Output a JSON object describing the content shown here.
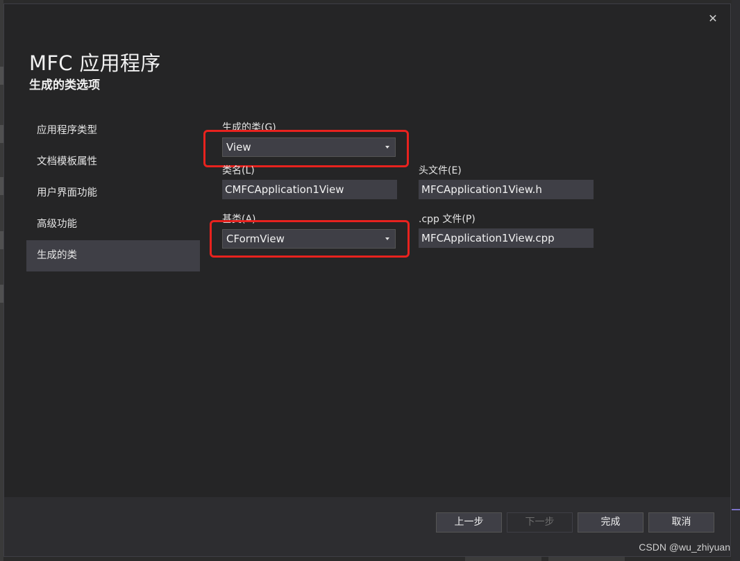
{
  "dialog": {
    "title": "MFC 应用程序",
    "subtitle": "生成的类选项",
    "close_glyph": "✕"
  },
  "nav": {
    "items": [
      {
        "label": "应用程序类型"
      },
      {
        "label": "文档模板属性"
      },
      {
        "label": "用户界面功能"
      },
      {
        "label": "高级功能"
      },
      {
        "label": "生成的类",
        "active": true
      }
    ]
  },
  "form": {
    "generated_class": {
      "label": "生成的类(G)",
      "value": "View"
    },
    "class_name": {
      "label": "类名(L)",
      "value": "CMFCApplication1View"
    },
    "header_file": {
      "label": "头文件(E)",
      "value": "MFCApplication1View.h"
    },
    "base_class": {
      "label": "基类(A)",
      "value": "CFormView"
    },
    "cpp_file": {
      "label": ".cpp 文件(P)",
      "value": "MFCApplication1View.cpp"
    }
  },
  "footer": {
    "prev_label": "上一步",
    "next_label": "下一步",
    "finish_label": "完成",
    "cancel_label": "取消"
  },
  "watermark": "CSDN @wu_zhiyuan",
  "icons": {
    "close": "close-icon",
    "dropdown": "chevron-down-icon"
  },
  "colors": {
    "highlight": "#e8221e",
    "dialog_bg": "#252526",
    "active_nav": "#3f3f46"
  }
}
